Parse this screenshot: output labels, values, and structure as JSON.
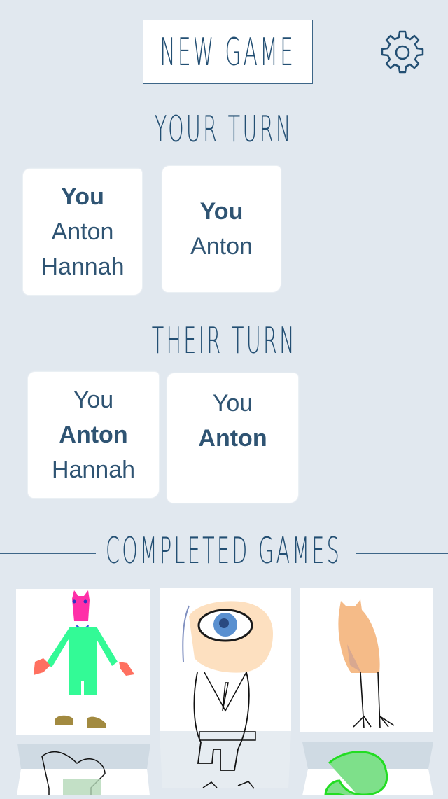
{
  "header": {
    "new_game_label": "NEW GAME",
    "settings_icon": "gear-icon"
  },
  "sections": {
    "your_turn": {
      "title": "YOUR TURN",
      "games": [
        {
          "players": [
            "You",
            "Anton",
            "Hannah"
          ],
          "current": "You"
        },
        {
          "players": [
            "You",
            "Anton"
          ],
          "current": "You"
        }
      ]
    },
    "their_turn": {
      "title": "THEIR TURN",
      "games": [
        {
          "players": [
            "You",
            "Anton",
            "Hannah"
          ],
          "current": "Anton"
        },
        {
          "players": [
            "You",
            "Anton"
          ],
          "current": "Anton"
        }
      ]
    },
    "completed": {
      "title": "COMPLETED GAMES"
    }
  },
  "colors": {
    "background": "#e1e8ef",
    "accent": "#234f73",
    "card": "#ffffff"
  }
}
